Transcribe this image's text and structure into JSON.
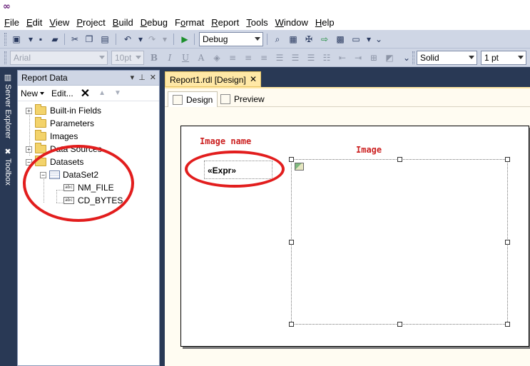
{
  "menu": {
    "items": [
      {
        "label": "File",
        "mnemonic": "F",
        "rest": "ile"
      },
      {
        "label": "Edit",
        "mnemonic": "E",
        "rest": "dit"
      },
      {
        "label": "View",
        "mnemonic": "V",
        "rest": "iew"
      },
      {
        "label": "Project",
        "mnemonic": "P",
        "rest": "roject"
      },
      {
        "label": "Build",
        "mnemonic": "B",
        "rest": "uild"
      },
      {
        "label": "Debug",
        "mnemonic": "D",
        "rest": "ebug"
      },
      {
        "label": "Format",
        "mnemonic": "o",
        "pre": "F",
        "rest": "rmat"
      },
      {
        "label": "Report",
        "mnemonic": "R",
        "rest": "eport"
      },
      {
        "label": "Tools",
        "mnemonic": "T",
        "rest": "ools"
      },
      {
        "label": "Window",
        "mnemonic": "W",
        "rest": "indow"
      },
      {
        "label": "Help",
        "mnemonic": "H",
        "rest": "elp"
      }
    ]
  },
  "toolbar": {
    "config": "Debug",
    "font_family": "Arial",
    "font_size": "10pt",
    "border_style": "Solid",
    "border_width": "1 pt"
  },
  "side_tabs": {
    "server_explorer": "Server Explorer",
    "toolbox": "Toolbox"
  },
  "report_data": {
    "title": "Report Data",
    "new_label": "New",
    "edit_label": "Edit...",
    "tree": {
      "builtin": "Built-in Fields",
      "parameters": "Parameters",
      "images": "Images",
      "data_sources": "Data Sources",
      "datasets": "Datasets",
      "dataset2": "DataSet2",
      "field1": "NM_FILE",
      "field2": "CD_BYTES"
    }
  },
  "document": {
    "tab_title": "Report1.rdl [Design]",
    "design_tab": "Design",
    "preview_tab": "Preview",
    "expr_text": "«Expr»"
  },
  "annotations": {
    "image_name": "Image name",
    "image": "Image"
  },
  "colors": {
    "annotation": "#e21d1d",
    "panel_bg": "#293955",
    "doc_tab": "#ffe8a6"
  }
}
